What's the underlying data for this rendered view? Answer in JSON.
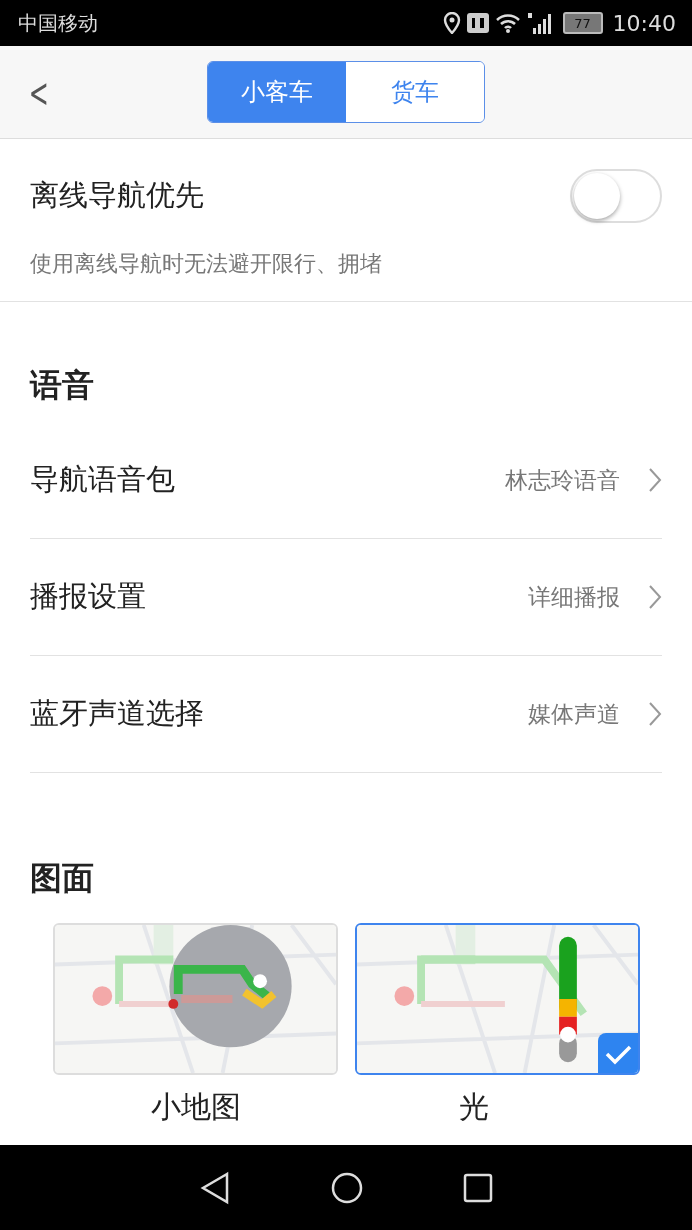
{
  "status_bar": {
    "carrier": "中国移动",
    "battery": "77",
    "time": "10:40"
  },
  "header": {
    "back": "<",
    "tabs": [
      {
        "label": "小客车",
        "selected": true
      },
      {
        "label": "货车",
        "selected": false
      }
    ]
  },
  "offline": {
    "title": "离线导航优先",
    "subtitle": "使用离线导航时无法避开限行、拥堵",
    "on": false
  },
  "voice": {
    "heading": "语音",
    "rows": [
      {
        "label": "导航语音包",
        "value": "林志玲语音"
      },
      {
        "label": "播报设置",
        "value": "详细播报"
      },
      {
        "label": "蓝牙声道选择",
        "value": "媒体声道"
      }
    ]
  },
  "display": {
    "heading": "图面",
    "styles": [
      {
        "label": "小地图",
        "selected": false,
        "kind": "minimap"
      },
      {
        "label": "光",
        "selected": true,
        "kind": "bar"
      }
    ]
  }
}
